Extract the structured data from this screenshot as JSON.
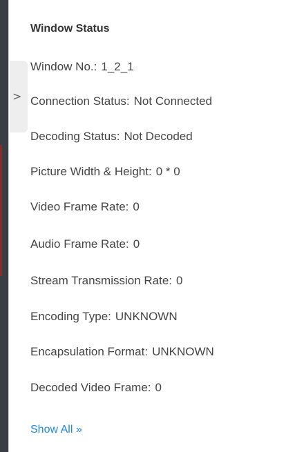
{
  "panel": {
    "title": "Window Status",
    "separator": ":",
    "rows": [
      {
        "label": "Window No.",
        "value": "1_2_1"
      },
      {
        "label": "Connection Status",
        "value": "Not Connected"
      },
      {
        "label": "Decoding Status",
        "value": "Not Decoded"
      },
      {
        "label": "Picture Width & Height",
        "value": "0 * 0"
      },
      {
        "label": "Video Frame Rate",
        "value": "0"
      },
      {
        "label": "Audio Frame Rate",
        "value": "0"
      },
      {
        "label": "Stream Transmission Rate",
        "value": "0"
      },
      {
        "label": "Encoding Type",
        "value": "UNKNOWN"
      },
      {
        "label": "Encapsulation Format",
        "value": "UNKNOWN"
      },
      {
        "label": "Decoded Video Frame",
        "value": "0"
      }
    ],
    "show_all_label": "Show All »",
    "collapse_glyph": ">"
  },
  "colors": {
    "link": "#1e88e5",
    "text": "#444444",
    "title": "#333333"
  }
}
